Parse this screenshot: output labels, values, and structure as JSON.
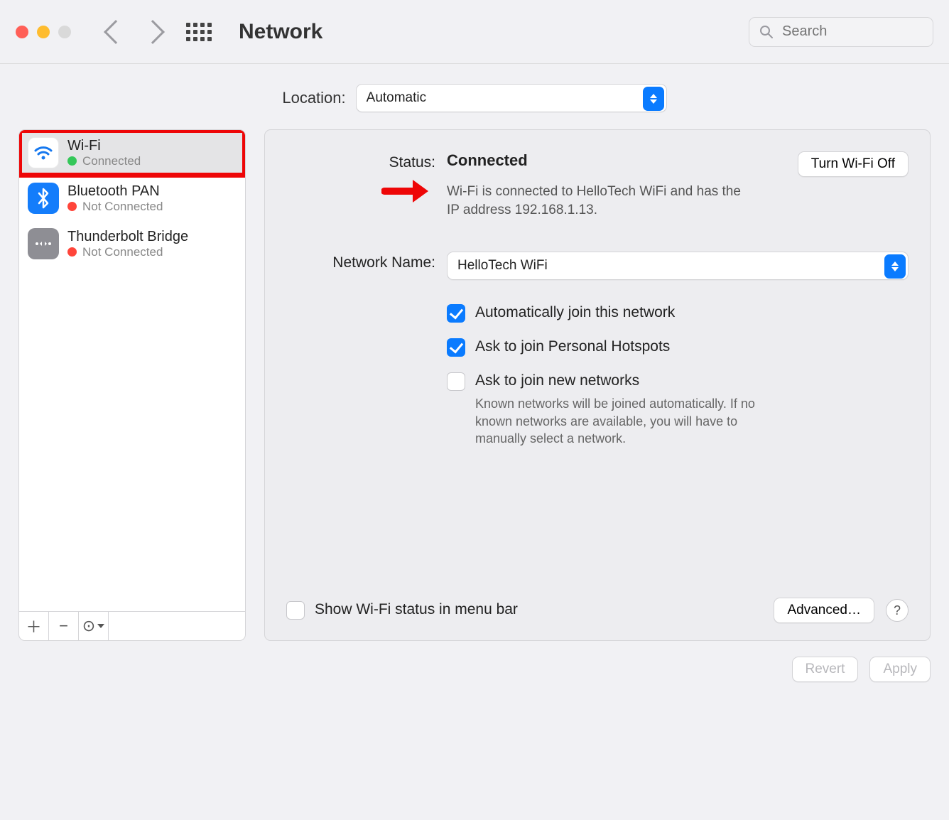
{
  "toolbar": {
    "title": "Network",
    "search_placeholder": "Search"
  },
  "location": {
    "label": "Location:",
    "value": "Automatic"
  },
  "sidebar": {
    "services": [
      {
        "name": "Wi-Fi",
        "status": "Connected",
        "status_color": "green",
        "icon": "wifi",
        "selected": true,
        "highlighted": true
      },
      {
        "name": "Bluetooth PAN",
        "status": "Not Connected",
        "status_color": "red",
        "icon": "bluetooth",
        "selected": false
      },
      {
        "name": "Thunderbolt Bridge",
        "status": "Not Connected",
        "status_color": "red",
        "icon": "thunderbolt",
        "selected": false
      }
    ]
  },
  "detail": {
    "status_label": "Status:",
    "status_value": "Connected",
    "toggle_button": "Turn Wi-Fi Off",
    "status_description": "Wi-Fi is connected to HelloTech WiFi and has the IP address 192.168.1.13.",
    "network_name_label": "Network Name:",
    "network_name_value": "HelloTech WiFi",
    "options": [
      {
        "label": "Automatically join this network",
        "checked": true
      },
      {
        "label": "Ask to join Personal Hotspots",
        "checked": true
      },
      {
        "label": "Ask to join new networks",
        "checked": false,
        "hint": "Known networks will be joined automatically. If no known networks are available, you will have to manually select a network."
      }
    ],
    "menu_bar_option": {
      "label": "Show Wi-Fi status in menu bar",
      "checked": false
    },
    "advanced_button": "Advanced…"
  },
  "footer": {
    "revert": "Revert",
    "apply": "Apply"
  }
}
